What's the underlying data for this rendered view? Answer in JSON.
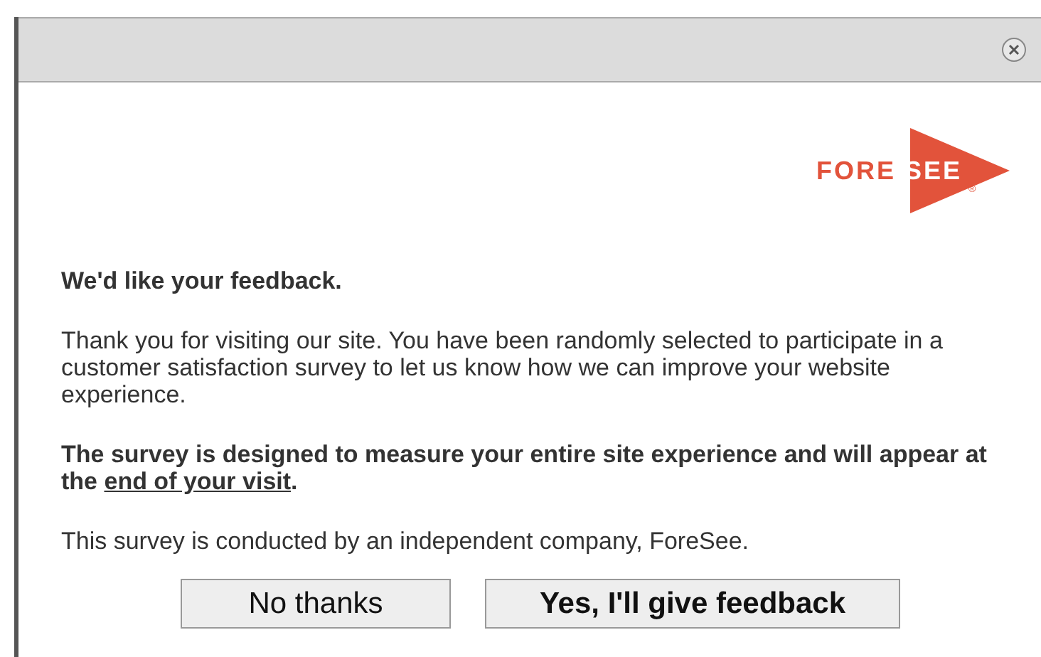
{
  "dialog": {
    "logo": {
      "part_1": "FORE",
      "part_2": "SEE",
      "mark": "®"
    },
    "heading": "We'd like your feedback.",
    "intro": "Thank you for visiting our site. You have been randomly selected to participate in a customer satisfaction survey to let us know how we can improve your website experience.",
    "notice": {
      "before": "The survey is designed to measure your entire site experience and will appear at the ",
      "link": "end of your visit",
      "after": "."
    },
    "disclaimer": "This survey is conducted by an independent company, ForeSee.",
    "buttons": [
      {
        "label": "No thanks",
        "kind": "secondary"
      },
      {
        "label": "Yes, I'll give feedback",
        "kind": "primary"
      }
    ]
  }
}
